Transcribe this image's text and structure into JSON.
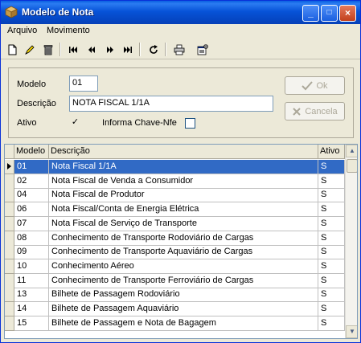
{
  "window": {
    "title": "Modelo de Nota",
    "icon": "package-icon",
    "controls": {
      "minimize": "_",
      "maximize": "□",
      "close": "×"
    }
  },
  "menu": {
    "items": [
      {
        "label": "Arquivo"
      },
      {
        "label": "Movimento"
      }
    ]
  },
  "toolbar": {
    "icons": [
      "new-icon",
      "edit-icon",
      "delete-icon",
      "first-icon",
      "prev-icon",
      "next-icon",
      "last-icon",
      "refresh-icon",
      "print-icon",
      "properties-icon"
    ]
  },
  "form": {
    "modelo_label": "Modelo",
    "modelo_value": "01",
    "descricao_label": "Descrição",
    "descricao_value": "NOTA FISCAL  1/1A",
    "ativo_label": "Ativo",
    "ativo_checked": "✓",
    "chave_label": "Informa Chave-Nfe",
    "chave_checked": "",
    "ok_label": "Ok",
    "cancel_label": "Cancela"
  },
  "grid": {
    "columns": [
      "Modelo",
      "Descrição",
      "Ativo"
    ],
    "rows": [
      [
        "01",
        "Nota Fiscal  1/1A",
        "S"
      ],
      [
        "02",
        "Nota Fiscal de Venda a Consumidor",
        "S"
      ],
      [
        "04",
        "Nota Fiscal de Produtor",
        "S"
      ],
      [
        "06",
        "Nota Fiscal/Conta de Energia Elétrica",
        "S"
      ],
      [
        "07",
        "Nota Fiscal de Serviço de Transporte",
        "S"
      ],
      [
        "08",
        "Conhecimento de Transporte Rodoviário de Cargas",
        "S"
      ],
      [
        "09",
        "Conhecimento de Transporte Aquaviário de Cargas",
        "S"
      ],
      [
        "10",
        "Conhecimento Aéreo",
        "S"
      ],
      [
        "11",
        "Conhecimento de Transporte Ferroviário de Cargas",
        "S"
      ],
      [
        "13",
        "Bilhete de Passagem Rodoviário",
        "S"
      ],
      [
        "14",
        "Bilhete de Passagem Aquaviário",
        "S"
      ],
      [
        "15",
        "Bilhete de Passagem e Nota de Bagagem",
        "S"
      ]
    ],
    "selected_index": 0
  },
  "colors": {
    "selection": "#316ac5",
    "titlebar": "#0753d8"
  }
}
